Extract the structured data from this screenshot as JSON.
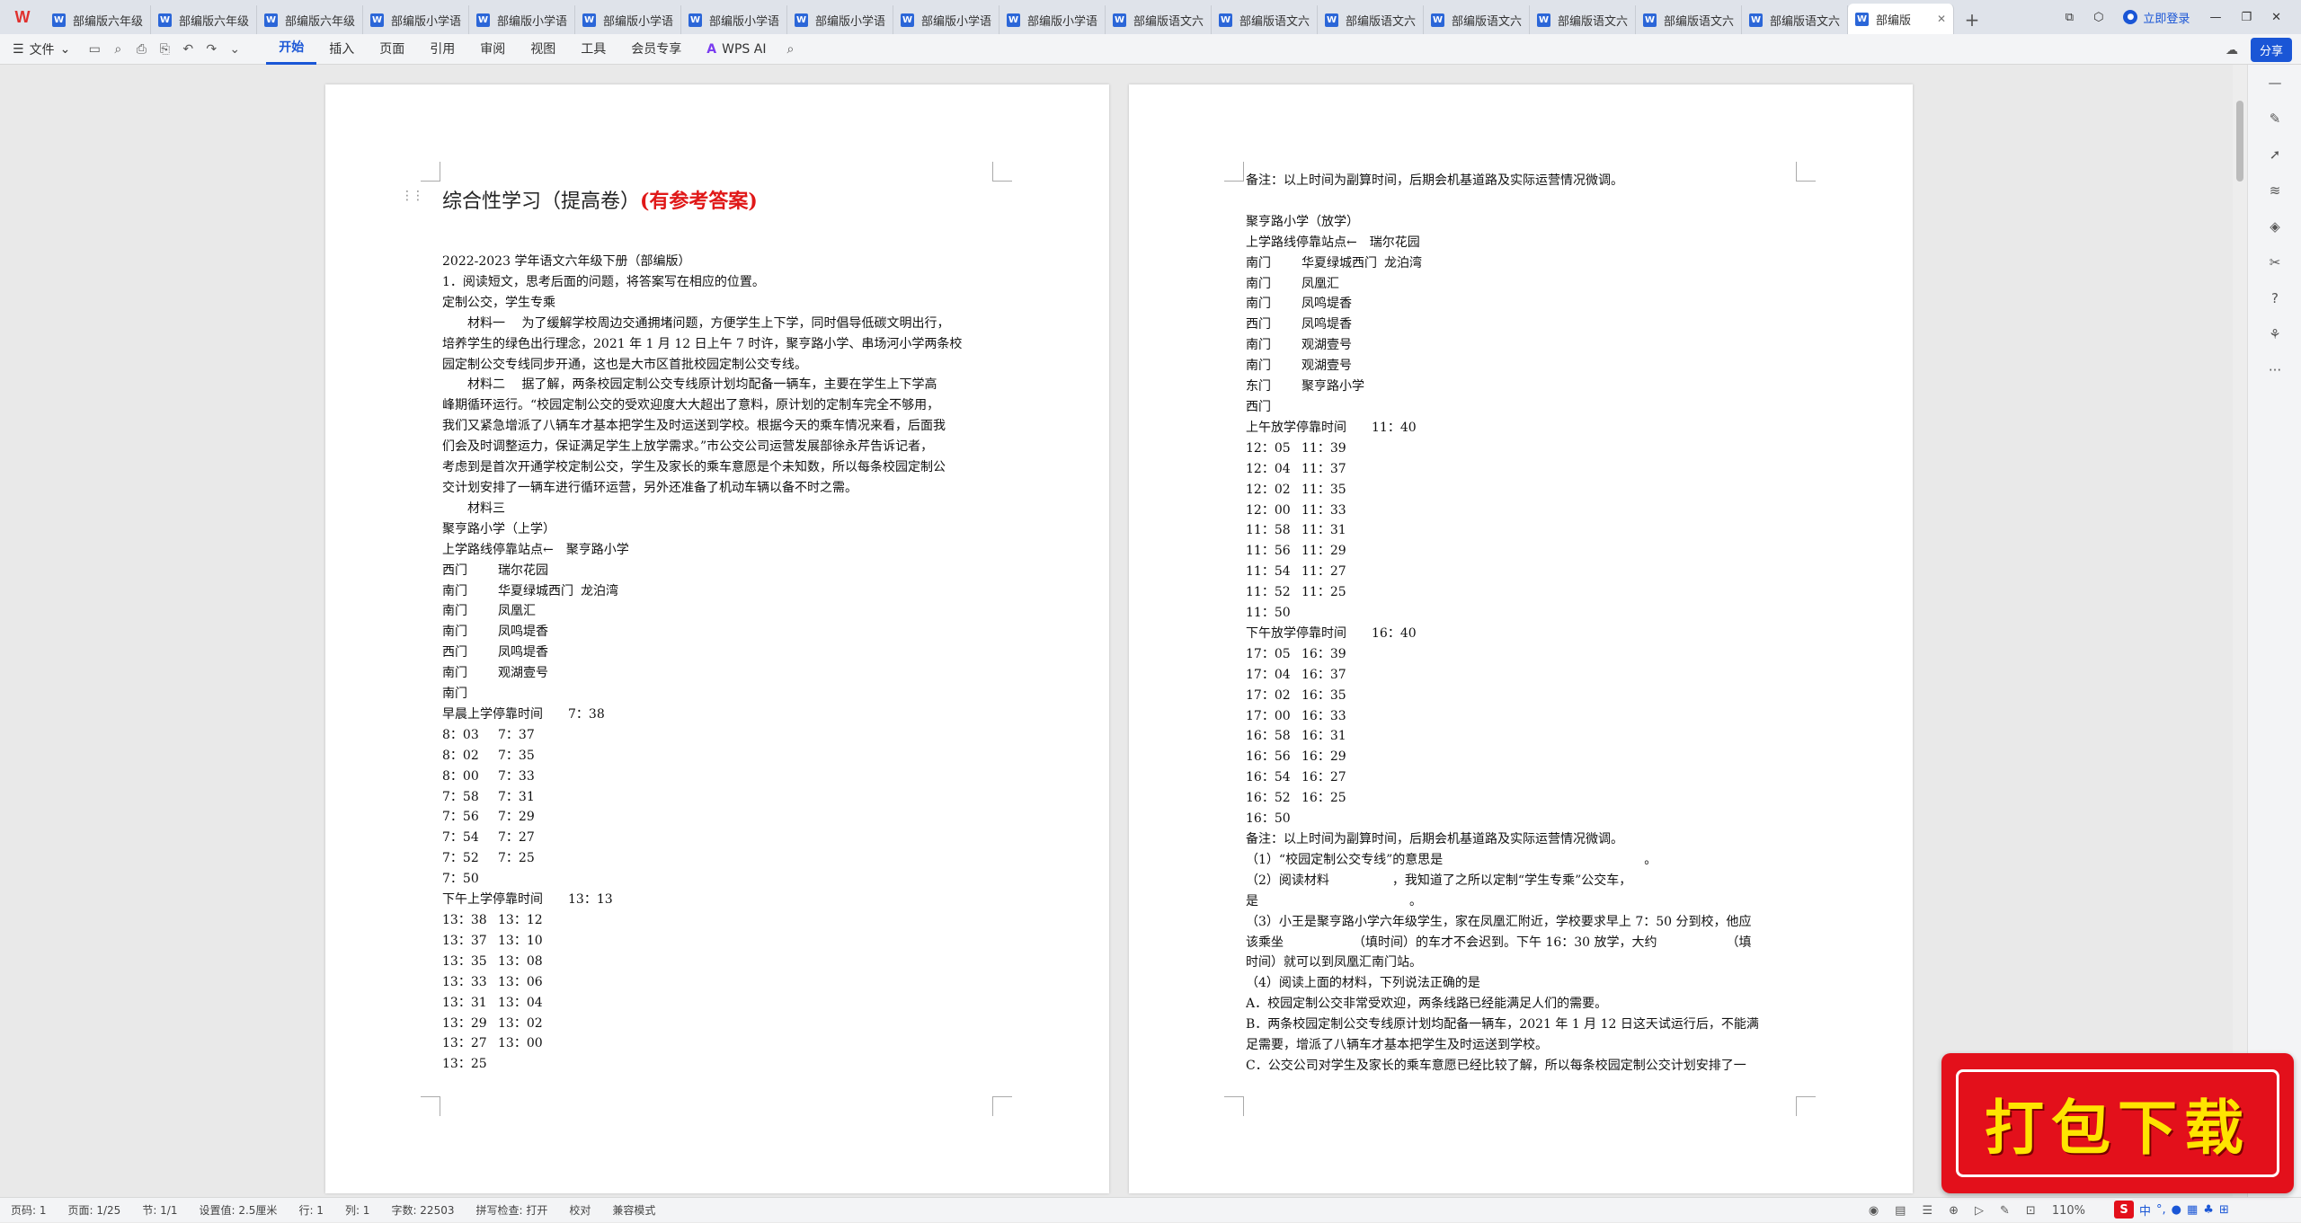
{
  "app": {
    "logo": "W"
  },
  "tabs": [
    {
      "label": "部编版六年级"
    },
    {
      "label": "部编版六年级"
    },
    {
      "label": "部编版六年级"
    },
    {
      "label": "部编版小学语"
    },
    {
      "label": "部编版小学语"
    },
    {
      "label": "部编版小学语"
    },
    {
      "label": "部编版小学语"
    },
    {
      "label": "部编版小学语"
    },
    {
      "label": "部编版小学语"
    },
    {
      "label": "部编版小学语"
    },
    {
      "label": "部编版语文六"
    },
    {
      "label": "部编版语文六"
    },
    {
      "label": "部编版语文六"
    },
    {
      "label": "部编版语文六"
    },
    {
      "label": "部编版语文六"
    },
    {
      "label": "部编版语文六"
    },
    {
      "label": "部编版语文六"
    },
    {
      "label": "部编版"
    }
  ],
  "tabbar": {
    "login": "立即登录",
    "new_tab": "+"
  },
  "toolbar": {
    "file": "文件",
    "menus": [
      "开始",
      "插入",
      "页面",
      "引用",
      "审阅",
      "视图",
      "工具",
      "会员专享"
    ],
    "wps_ai": "WPS AI",
    "share": "分享"
  },
  "doc": {
    "title": "综合性学习（提高卷）",
    "title_red": "(有参考答案)",
    "page1": [
      "2022-2023 学年语文六年级下册（部编版）",
      "1．阅读短文，思考后面的问题，将答案写在相应的位置。",
      "定制公交，学生专乘",
      "材料一　 为了缓解学校周边交通拥堵问题，方便学生上下学，同时倡导低碳文明出行，",
      "培养学生的绿色出行理念，2021 年 1 月 12 日上午 7 时许，聚亨路小学、串场河小学两条校",
      "园定制公交专线同步开通，这也是大市区首批校园定制公交专线。",
      "材料二　 据了解，两条校园定制公交专线原计划均配备一辆车，主要在学生上下学高",
      "峰期循环运行。“校园定制公交的受欢迎度大大超出了意料，原计划的定制车完全不够用，",
      "我们又紧急增派了八辆车才基本把学生及时运送到学校。根据今天的乘车情况来看，后面我",
      "们会及时调整运力，保证满足学生上放学需求。”市公交公司运营发展部徐永芹告诉记者，",
      "考虑到是首次开通学校定制公交，学生及家长的乘车意愿是个未知数，所以每条校园定制公",
      "交计划安排了一辆车进行循环运营，另外还准备了机动车辆以备不时之需。",
      "材料三",
      "聚亨路小学（上学）",
      "上学路线停靠站点←　聚亨路小学",
      [
        "西门",
        "瑞尔花园"
      ],
      [
        "南门",
        "华夏绿城西门",
        "龙泊湾"
      ],
      [
        "南门",
        "凤凰汇"
      ],
      [
        "南门",
        "凤鸣堤香"
      ],
      [
        "西门",
        "凤鸣堤香"
      ],
      [
        "南门",
        "观湖壹号"
      ],
      [
        "南门"
      ],
      "早晨上学停靠时间　　7：38",
      [
        "8：03",
        "7：37"
      ],
      [
        "8：02",
        "7：35"
      ],
      [
        "8：00",
        "7：33"
      ],
      [
        "7：58",
        "7：31"
      ],
      [
        "7：56",
        "7：29"
      ],
      [
        "7：54",
        "7：27"
      ],
      [
        "7：52",
        "7：25"
      ],
      [
        "7：50"
      ],
      "下午上学停靠时间　　13：13",
      [
        "13：38",
        "13：12"
      ],
      [
        "13：37",
        "13：10"
      ],
      [
        "13：35",
        "13：08"
      ],
      [
        "13：33",
        "13：06"
      ],
      [
        "13：31",
        "13：04"
      ],
      [
        "13：29",
        "13：02"
      ],
      [
        "13：27",
        "13：00"
      ],
      [
        "13：25"
      ]
    ],
    "page2": [
      "备注：以上时间为副算时间，后期会机基道路及实际运营情况微调。",
      "",
      "聚亨路小学（放学）",
      "上学路线停靠站点←　瑞尔花园",
      [
        "南门",
        "华夏绿城西门",
        "龙泊湾"
      ],
      [
        "南门",
        "凤凰汇"
      ],
      [
        "南门",
        "凤鸣堤香"
      ],
      [
        "西门",
        "凤鸣堤香"
      ],
      [
        "南门",
        "观湖壹号"
      ],
      [
        "南门",
        "观湖壹号"
      ],
      [
        "东门",
        "聚亨路小学"
      ],
      [
        "西门"
      ],
      "上午放学停靠时间　　11：40",
      [
        "12：05",
        "11：39"
      ],
      [
        "12：04",
        "11：37"
      ],
      [
        "12：02",
        "11：35"
      ],
      [
        "12：00",
        "11：33"
      ],
      [
        "11：58",
        "11：31"
      ],
      [
        "11：56",
        "11：29"
      ],
      [
        "11：54",
        "11：27"
      ],
      [
        "11：52",
        "11：25"
      ],
      [
        "11：50"
      ],
      "下午放学停靠时间　　16：40",
      [
        "17：05",
        "16：39"
      ],
      [
        "17：04",
        "16：37"
      ],
      [
        "17：02",
        "16：35"
      ],
      [
        "17：00",
        "16：33"
      ],
      [
        "16：58",
        "16：31"
      ],
      [
        "16：56",
        "16：29"
      ],
      [
        "16：54",
        "16：27"
      ],
      [
        "16：52",
        "16：25"
      ],
      [
        "16：50"
      ],
      "备注：以上时间为副算时间，后期会机基道路及实际运营情况微调。",
      "（1）“校园定制公交专线”的意思是　　　　　　　　　　　　　　　　。",
      "（2）阅读材料　　　　　，我知道了之所以定制“学生专乘”公交车，",
      "是　　　　　　　　　　　　。",
      "（3）小王是聚亨路小学六年级学生，家在凤凰汇附近，学校要求早上 7：50 分到校，他应",
      "该乘坐　　　　　　（填时间）的车才不会迟到。下午 16：30 放学，大约　　　　　　（填",
      "时间）就可以到凤凰汇南门站。",
      "（4）阅读上面的材料，下列说法正确的是",
      "A．校园定制公交非常受欢迎，两条线路已经能满足人们的需要。",
      "B．两条校园定制公交专线原计划均配备一辆车，2021 年 1 月 12 日这天试运行后，不能满",
      "足需要，增派了八辆车才基本把学生及时运送到学校。",
      "C．公交公司对学生及家长的乘车意愿已经比较了解，所以每条校园定制公交计划安排了一"
    ]
  },
  "statusbar": {
    "page": "页码: 1",
    "pages": "页面: 1/25",
    "section": "节: 1/1",
    "setting": "设置值: 2.5厘米",
    "row": "行: 1",
    "col": "列: 1",
    "words": "字数: 22503",
    "spell": "拼写检查: 打开",
    "proof": "校对",
    "compat": "兼容模式",
    "zoom": "110%"
  },
  "promo": {
    "text": "打包下载"
  },
  "ime": {
    "s5": "S",
    "text": "中"
  }
}
